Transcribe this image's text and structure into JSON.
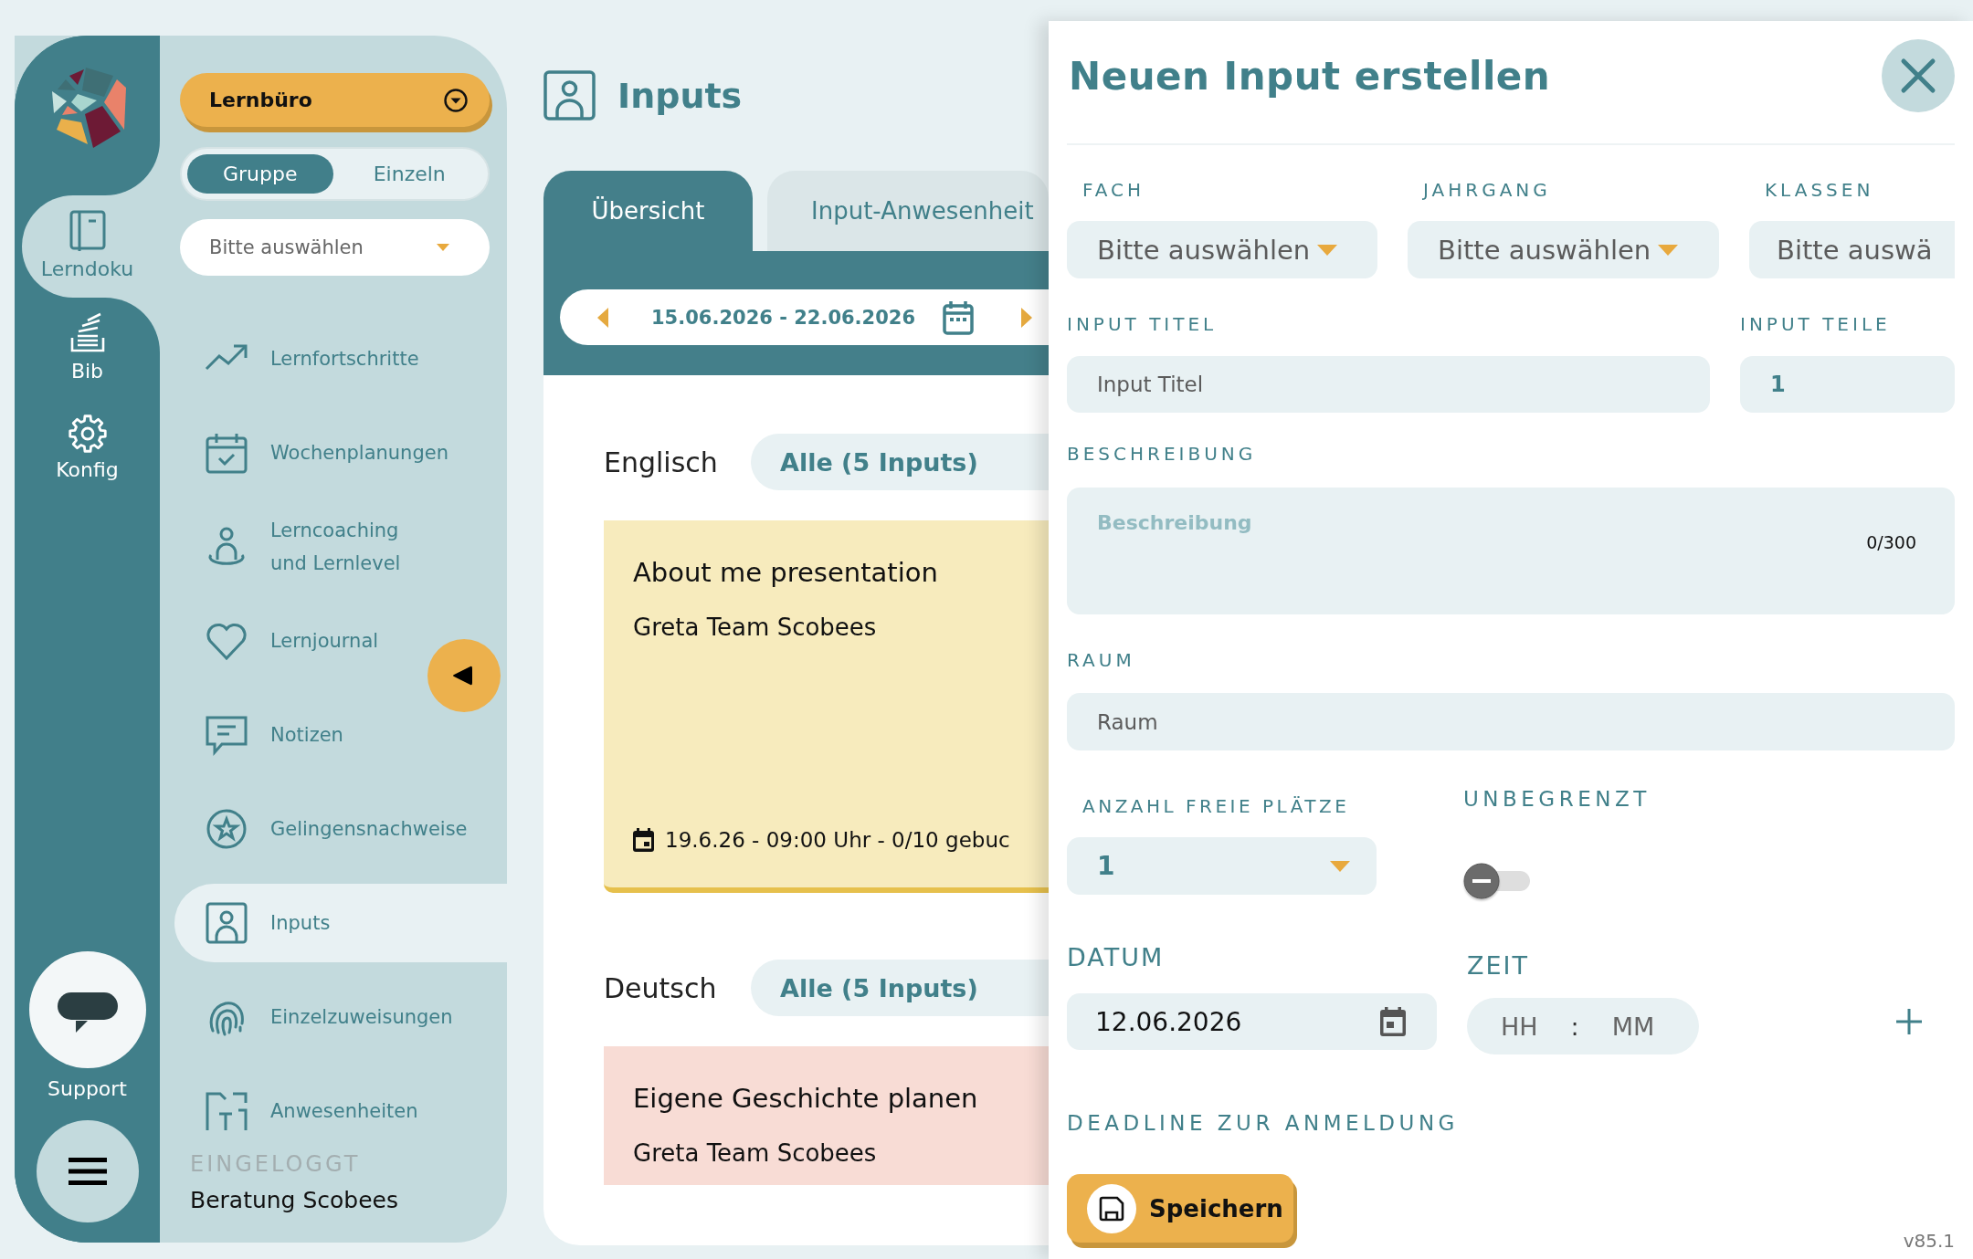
{
  "rail": {
    "items": [
      {
        "label": "Lerndoku",
        "selected": true
      },
      {
        "label": "Bib",
        "selected": false
      },
      {
        "label": "Konfig",
        "selected": false
      }
    ],
    "support": "Support"
  },
  "sidebar": {
    "context": "Lernbüro",
    "modes": [
      {
        "label": "Gruppe",
        "selected": true
      },
      {
        "label": "Einzeln",
        "selected": false
      }
    ],
    "group_select": {
      "placeholder": "Bitte auswählen"
    },
    "items": [
      {
        "label": "Lernfortschritte",
        "selected": false
      },
      {
        "label": "Wochenplanungen",
        "selected": false
      },
      {
        "label": "Lerncoaching\nund Lernlevel",
        "selected": false
      },
      {
        "label": "Lernjournal",
        "selected": false
      },
      {
        "label": "Notizen",
        "selected": false
      },
      {
        "label": "Gelingensnachweise",
        "selected": false
      },
      {
        "label": "Inputs",
        "selected": true
      },
      {
        "label": "Einzelzuweisungen",
        "selected": false
      },
      {
        "label": "Anwesenheiten",
        "selected": false
      }
    ],
    "logged_in_label": "EINGELOGGT",
    "user": "Beratung Scobees"
  },
  "page": {
    "title": "Inputs",
    "tabs": [
      {
        "label": "Übersicht",
        "selected": true
      },
      {
        "label": "Input-Anwesenheit",
        "selected": false
      }
    ],
    "date_range": "15.06.2026 - 22.06.2026",
    "sections": [
      {
        "subject": "Englisch",
        "filter": "Alle (5 Inputs)",
        "cards": [
          {
            "title": "About me presentation",
            "teacher": "Greta Team Scobees",
            "schedule": "19.6.26 - 09:00 Uhr - 0/10 gebuc",
            "color": "#f7ebbd"
          }
        ]
      },
      {
        "subject": "Deutsch",
        "filter": "Alle (5 Inputs)",
        "cards": [
          {
            "title": "Eigene Geschichte planen",
            "teacher": "Greta Team Scobees",
            "color": "#f8dcd5"
          }
        ]
      }
    ]
  },
  "panel": {
    "title": "Neuen Input erstellen",
    "selects": [
      {
        "label": "FACH",
        "placeholder": "Bitte auswählen",
        "cut_off": false
      },
      {
        "label": "JAHRGANG",
        "placeholder": "Bitte auswählen",
        "cut_off": false
      },
      {
        "label": "KLASSEN",
        "placeholder": "Bitte auswä",
        "cut_off": true
      }
    ],
    "title_field": {
      "label": "INPUT TITEL",
      "placeholder": "Input Titel"
    },
    "parts_field": {
      "label": "INPUT TEILE",
      "value": "1"
    },
    "description": {
      "label": "BESCHREIBUNG",
      "placeholder": "Beschreibung",
      "counter": "0/300"
    },
    "room": {
      "label": "RAUM",
      "placeholder": "Raum"
    },
    "free_places": {
      "label": "ANZAHL FREIE PLÄTZE",
      "value": "1"
    },
    "unlimited": {
      "label": "UNBEGRENZT",
      "on": false
    },
    "date": {
      "label": "DATUM",
      "value": "12.06.2026"
    },
    "time": {
      "label": "ZEIT",
      "hours_placeholder": "HH",
      "separator": ":",
      "minutes_placeholder": "MM"
    },
    "deadline_label": "DEADLINE ZUR ANMELDUNG",
    "save_button": "Speichern",
    "version": "v85.1"
  }
}
